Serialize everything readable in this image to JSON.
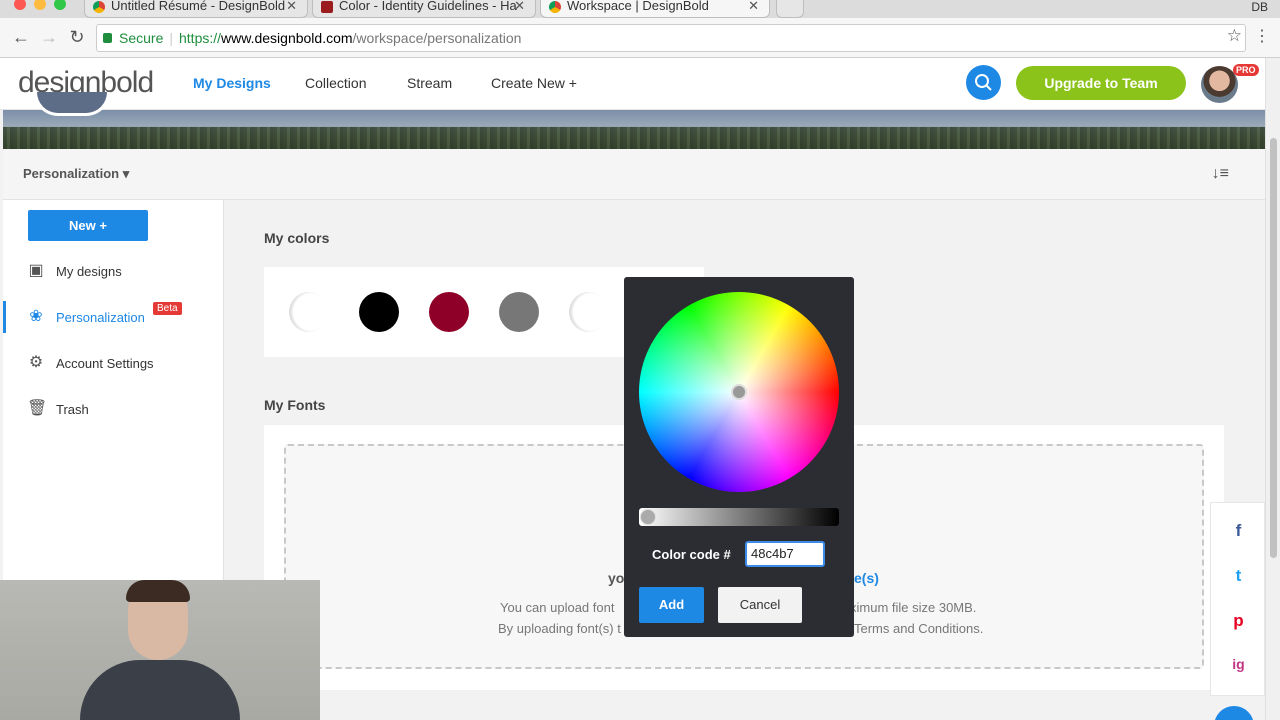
{
  "browser": {
    "tabs": [
      {
        "title": "Untitled Résumé - DesignBold"
      },
      {
        "title": "Color - Identity Guidelines - Ha"
      },
      {
        "title": "Workspace | DesignBold"
      }
    ],
    "user_initials": "DB",
    "address": {
      "secure_label": "Secure",
      "scheme": "https://",
      "host": "www.designbold.com",
      "path": "/workspace/personalization"
    }
  },
  "header": {
    "logo": "designbold",
    "nav": [
      "My Designs",
      "Collection",
      "Stream",
      "Create New +"
    ],
    "upgrade_label": "Upgrade to Team",
    "pro_badge": "PRO"
  },
  "subheader": {
    "title": "Personalization ▾"
  },
  "sidebar": {
    "new_label": "New +",
    "items": [
      {
        "label": "My designs",
        "icon": "image-icon"
      },
      {
        "label": "Personalization",
        "icon": "paw-icon",
        "badge": "Beta"
      },
      {
        "label": "Account Settings",
        "icon": "gear-icon"
      },
      {
        "label": "Trash",
        "icon": "trash-icon"
      }
    ]
  },
  "main": {
    "colors_title": "My colors",
    "swatches": [
      "#ffffff",
      "#000000",
      "#8f0028",
      "#777777",
      "#ffffff"
    ],
    "fonts_title": "My Fonts",
    "dropzone": {
      "lead_partial": "yo",
      "link_partial": "e(s)",
      "line1_left": "You can upload font",
      "line1_right": "ximum file size 30MB.",
      "line2_left": "By uploading font(s) t",
      "line2_right": "Terms and Conditions."
    }
  },
  "picker": {
    "code_label": "Color code #",
    "code_value": "48c4b7",
    "add_label": "Add",
    "cancel_label": "Cancel"
  },
  "social": [
    "f",
    "t",
    "p",
    "ig"
  ],
  "colors": {
    "accent": "#1e88e5",
    "upgrade": "#8bc31b",
    "badge": "#e53935",
    "picker_bg": "#2b2d33"
  }
}
